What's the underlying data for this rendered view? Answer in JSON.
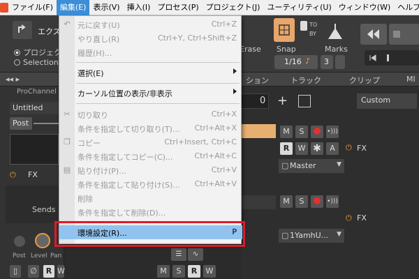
{
  "menubar": {
    "items": [
      {
        "label": "ファイル(F)"
      },
      {
        "label": "編集(E)"
      },
      {
        "label": "表示(V)"
      },
      {
        "label": "挿入(I)"
      },
      {
        "label": "プロセス(P)"
      },
      {
        "label": "プロジェクト(J)"
      },
      {
        "label": "ユーティリティ(U)"
      },
      {
        "label": "ウィンドウ(W)"
      },
      {
        "label": "ヘルプ(H)"
      }
    ]
  },
  "toolbar": {
    "export_label": "エクス",
    "project_radio": "プロジェクト",
    "selection_radio": "Selection",
    "erase_label": "Erase",
    "snap_label": "Snap",
    "marks_label": "Marks",
    "snap_value": "1/16",
    "marks_value": "3",
    "to_label": "TO",
    "by_label": "BY",
    "custom_label": "Custom",
    "zoom_value": "0"
  },
  "track_header": {
    "tabs": [
      {
        "label": "ション"
      },
      {
        "label": "トラック"
      },
      {
        "label": "クリップ"
      },
      {
        "label": "MI"
      }
    ]
  },
  "left_pane": {
    "prochannel_label": "ProChannel",
    "untitled_label": "Untitled",
    "post_label": "Post",
    "fx_label": "FX",
    "sends_label": "Sends",
    "post_knob": "Post",
    "level_knob": "Level",
    "pan_knob": "Pan"
  },
  "tracks": {
    "track1": {
      "output": "Master",
      "fx": "FX"
    },
    "track2": {
      "output": "1YamhU...",
      "fx": "FX"
    }
  },
  "edit_menu": {
    "items": [
      {
        "label": "元に戻す(U)",
        "shortcut": "Ctrl+Z"
      },
      {
        "label": "やり直し(R)",
        "shortcut": "Ctrl+Y, Ctrl+Shift+Z"
      },
      {
        "label": "履歴(H)...",
        "shortcut": ""
      },
      {
        "label": "選択(E)",
        "shortcut": ""
      },
      {
        "label": "カーソル位置の表示/非表示",
        "shortcut": ""
      },
      {
        "label": "切り取り",
        "shortcut": "Ctrl+X"
      },
      {
        "label": "条件を指定して切り取り(T)...",
        "shortcut": "Ctrl+Alt+X"
      },
      {
        "label": "コピー",
        "shortcut": "Ctrl+Insert, Ctrl+C"
      },
      {
        "label": "条件を指定してコピー(C)...",
        "shortcut": "Ctrl+Alt+C"
      },
      {
        "label": "貼り付け(P)...",
        "shortcut": "Ctrl+V"
      },
      {
        "label": "条件を指定して貼り付け(S)...",
        "shortcut": "Ctrl+Alt+V"
      },
      {
        "label": "削除",
        "shortcut": ""
      },
      {
        "label": "条件を指定して削除(D)...",
        "shortcut": ""
      },
      {
        "label": "環境設定(R)...",
        "shortcut": "P"
      }
    ]
  },
  "colors": {
    "active_menu": "#3c8ed6",
    "highlight": "#92c3ee",
    "callout": "#e0192a"
  }
}
